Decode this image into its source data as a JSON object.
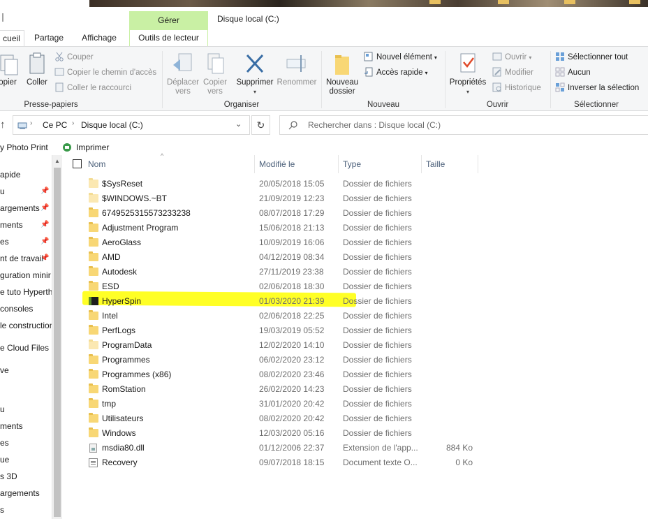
{
  "window": {
    "context_tab_header": "Gérer",
    "title": "Disque local (C:)"
  },
  "tabs": [
    {
      "label": "cueil",
      "active": true
    },
    {
      "label": "Partage"
    },
    {
      "label": "Affichage"
    },
    {
      "label": "Outils de lecteur"
    }
  ],
  "ribbon": {
    "clipboard": {
      "label": "Presse-papiers",
      "pin_label": "opier",
      "paste": "Coller",
      "cut": "Couper",
      "copy_path": "Copier le chemin d'accès",
      "paste_shortcut": "Coller le raccourci"
    },
    "organize": {
      "label": "Organiser",
      "move_to": [
        "Déplacer",
        "vers"
      ],
      "copy_to": [
        "Copier",
        "vers"
      ],
      "delete": "Supprimer",
      "rename": "Renommer"
    },
    "new": {
      "label": "Nouveau",
      "new_folder": [
        "Nouveau",
        "dossier"
      ],
      "new_item": "Nouvel élément",
      "easy_access": "Accès rapide"
    },
    "open": {
      "label": "Ouvrir",
      "properties": "Propriétés",
      "open": "Ouvrir",
      "edit": "Modifier",
      "history": "Historique"
    },
    "select": {
      "label": "Sélectionner",
      "select_all": "Sélectionner tout",
      "select_none": "Aucun",
      "invert": "Inverser la sélection"
    }
  },
  "address": {
    "crumbs": [
      "Ce PC",
      "Disque local (C:)"
    ],
    "search_placeholder": "Rechercher dans : Disque local (C:)"
  },
  "toolbar": {
    "item1": "y Photo Print",
    "print": "Imprimer"
  },
  "nav": [
    {
      "label": "apide",
      "pin": false
    },
    {
      "label": "u",
      "pin": true
    },
    {
      "label": "argements",
      "pin": true
    },
    {
      "label": "ments",
      "pin": true
    },
    {
      "label": "es",
      "pin": true
    },
    {
      "label": "nt de travail",
      "pin": true
    },
    {
      "label": "guration minir",
      "pin": false
    },
    {
      "label": "e tuto Hyperth",
      "pin": false
    },
    {
      "label": "consoles",
      "pin": false
    },
    {
      "label": "le construction",
      "pin": false
    },
    {
      "label": "e Cloud Files",
      "pin": false
    },
    {
      "label": "ve",
      "pin": false
    },
    {
      "label": "u",
      "pin": false
    },
    {
      "label": "ments",
      "pin": false
    },
    {
      "label": "es",
      "pin": false
    },
    {
      "label": "ue",
      "pin": false
    },
    {
      "label": "s 3D",
      "pin": false
    },
    {
      "label": "argements",
      "pin": false
    },
    {
      "label": "s",
      "pin": false
    }
  ],
  "columns": {
    "name": "Nom",
    "modified": "Modifié le",
    "type": "Type",
    "size": "Taille"
  },
  "files": [
    {
      "name": "$SysReset",
      "date": "20/05/2018 15:05",
      "type": "Dossier de fichiers",
      "size": "",
      "icon": "folder-faint"
    },
    {
      "name": "$WINDOWS.~BT",
      "date": "21/09/2019 12:23",
      "type": "Dossier de fichiers",
      "size": "",
      "icon": "folder-faint"
    },
    {
      "name": "6749525315573233238",
      "date": "08/07/2018 17:29",
      "type": "Dossier de fichiers",
      "size": "",
      "icon": "folder"
    },
    {
      "name": "Adjustment Program",
      "date": "15/06/2018 21:13",
      "type": "Dossier de fichiers",
      "size": "",
      "icon": "folder"
    },
    {
      "name": "AeroGlass",
      "date": "10/09/2019 16:06",
      "type": "Dossier de fichiers",
      "size": "",
      "icon": "folder"
    },
    {
      "name": "AMD",
      "date": "04/12/2019 08:34",
      "type": "Dossier de fichiers",
      "size": "",
      "icon": "folder"
    },
    {
      "name": "Autodesk",
      "date": "27/11/2019 23:38",
      "type": "Dossier de fichiers",
      "size": "",
      "icon": "folder"
    },
    {
      "name": "ESD",
      "date": "02/06/2018 18:30",
      "type": "Dossier de fichiers",
      "size": "",
      "icon": "folder"
    },
    {
      "name": "HyperSpin",
      "date": "01/03/2020 21:39",
      "type": "Dossier de fichiers",
      "size": "",
      "icon": "hyperspin"
    },
    {
      "name": "Intel",
      "date": "02/06/2018 22:25",
      "type": "Dossier de fichiers",
      "size": "",
      "icon": "folder"
    },
    {
      "name": "PerfLogs",
      "date": "19/03/2019 05:52",
      "type": "Dossier de fichiers",
      "size": "",
      "icon": "folder"
    },
    {
      "name": "ProgramData",
      "date": "12/02/2020 14:10",
      "type": "Dossier de fichiers",
      "size": "",
      "icon": "folder-faint"
    },
    {
      "name": "Programmes",
      "date": "06/02/2020 23:12",
      "type": "Dossier de fichiers",
      "size": "",
      "icon": "folder"
    },
    {
      "name": "Programmes (x86)",
      "date": "08/02/2020 23:46",
      "type": "Dossier de fichiers",
      "size": "",
      "icon": "folder"
    },
    {
      "name": "RomStation",
      "date": "26/02/2020 14:23",
      "type": "Dossier de fichiers",
      "size": "",
      "icon": "folder"
    },
    {
      "name": "tmp",
      "date": "31/01/2020 20:42",
      "type": "Dossier de fichiers",
      "size": "",
      "icon": "folder"
    },
    {
      "name": "Utilisateurs",
      "date": "08/02/2020 20:42",
      "type": "Dossier de fichiers",
      "size": "",
      "icon": "folder"
    },
    {
      "name": "Windows",
      "date": "12/03/2020 05:16",
      "type": "Dossier de fichiers",
      "size": "",
      "icon": "folder"
    },
    {
      "name": "msdia80.dll",
      "date": "01/12/2006 22:37",
      "type": "Extension de l'app...",
      "size": "884 Ko",
      "icon": "dll"
    },
    {
      "name": "Recovery",
      "date": "09/07/2018 18:15",
      "type": "Document texte O...",
      "size": "0 Ko",
      "icon": "txt"
    }
  ],
  "colors": {
    "context_tab": "#c9f0a4",
    "folder": "#f8d775",
    "highlight": "#ffff00",
    "header_text": "#4c607a"
  }
}
